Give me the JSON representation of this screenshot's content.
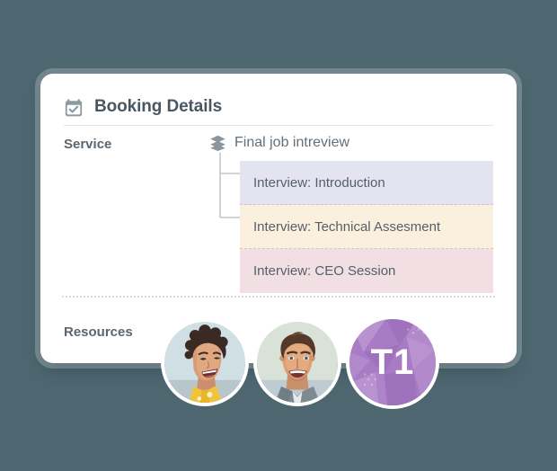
{
  "background_color": "#4d6670",
  "card": {
    "background_color": "#ffffff",
    "header": {
      "icon": "calendar-check-icon",
      "title": "Booking Details"
    },
    "fields": [
      {
        "key": "service",
        "label": "Service"
      },
      {
        "key": "resources",
        "label": "Resources"
      }
    ],
    "service": {
      "label": "Service",
      "icon": "stack-layers-icon",
      "value": "Final job intreview",
      "sessions": [
        {
          "label": "Interview: Introduction",
          "color": "#e3e4f0"
        },
        {
          "label": "Interview: Technical Assesment",
          "color": "#faf0dd"
        },
        {
          "label": "Interview: CEO Session",
          "color": "#f2dfe4"
        }
      ]
    },
    "resources": {
      "label": "Resources",
      "avatars": [
        {
          "name": "avatar-photo-woman",
          "type": "photo",
          "alt": "Smiling woman with short curly dark hair",
          "background_color": "#cfdfe3"
        },
        {
          "name": "avatar-photo-man",
          "type": "photo",
          "alt": "Smiling man with brown hair",
          "background_color": "#d9e2d6"
        },
        {
          "name": "avatar-initials-t1",
          "type": "initials",
          "initials": "T1",
          "background_color": "#a87cc4"
        }
      ]
    }
  }
}
